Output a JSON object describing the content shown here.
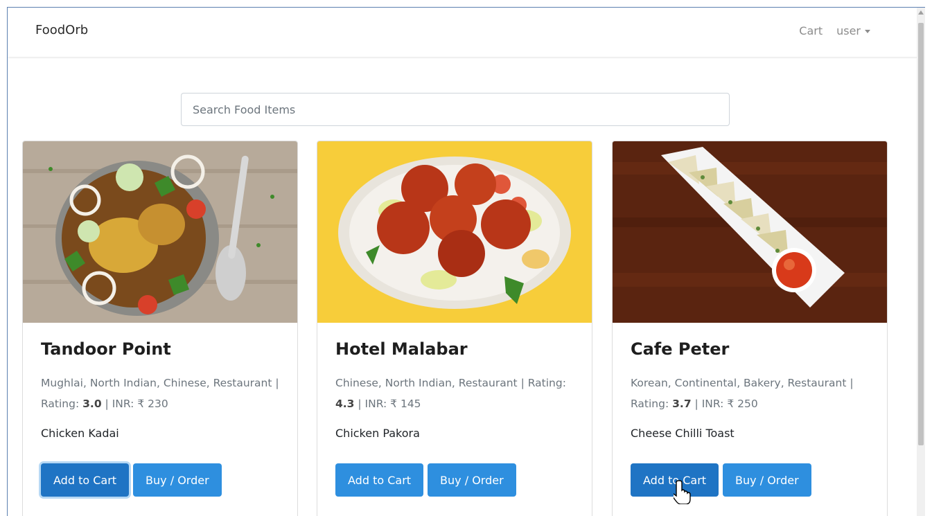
{
  "navbar": {
    "brand": "FoodOrb",
    "cart_label": "Cart",
    "user_label": "user"
  },
  "search": {
    "placeholder": "Search Food Items",
    "value": ""
  },
  "cards": [
    {
      "title": "Tandoor Point",
      "cuisine": "Mughlai, North Indian, Chinese, Restaurant",
      "rating_label": "Rating:",
      "rating": "3.0",
      "price_label": "INR:",
      "price": "₹ 230",
      "item": "Chicken Kadai",
      "add_label": "Add to Cart",
      "buy_label": "Buy / Order"
    },
    {
      "title": "Hotel Malabar",
      "cuisine": "Chinese, North Indian, Restaurant",
      "rating_label": "Rating:",
      "rating": "4.3",
      "price_label": "INR:",
      "price": "₹ 145",
      "item": "Chicken Pakora",
      "add_label": "Add to Cart",
      "buy_label": "Buy / Order"
    },
    {
      "title": "Cafe Peter",
      "cuisine": "Korean, Continental, Bakery, Restaurant",
      "rating_label": "Rating:",
      "rating": "3.7",
      "price_label": "INR:",
      "price": "₹ 250",
      "item": "Cheese Chilli Toast",
      "add_label": "Add to Cart",
      "buy_label": "Buy / Order"
    }
  ],
  "colors": {
    "primary": "#2e8fdf",
    "primary_dark": "#1f74c4",
    "muted": "#6c757d"
  }
}
